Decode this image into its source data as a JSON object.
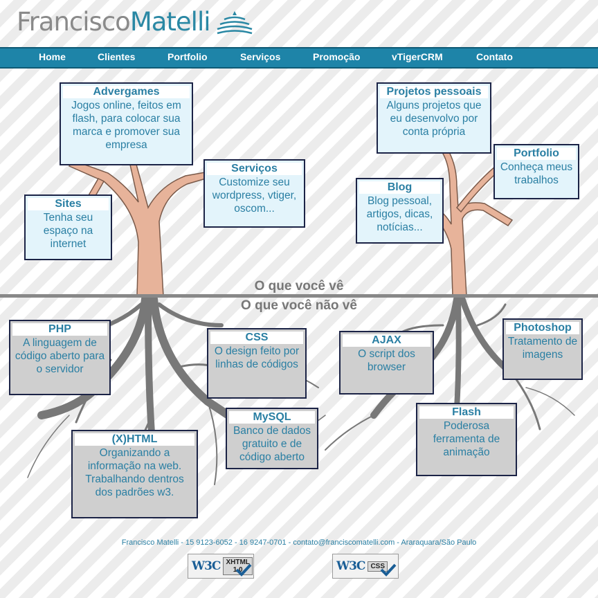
{
  "logo": {
    "first": "Francisco",
    "last": "Matelli"
  },
  "nav": {
    "items": [
      {
        "label": "Home"
      },
      {
        "label": "Clientes"
      },
      {
        "label": "Portfolio"
      },
      {
        "label": "Serviços"
      },
      {
        "label": "Promoção"
      },
      {
        "label": "vTigerCRM"
      },
      {
        "label": "Contato"
      }
    ]
  },
  "scene": {
    "seen": "O que você vê",
    "unseen": "O que você não vê"
  },
  "cards": {
    "advergames": {
      "title": "Advergames",
      "desc": "Jogos online, feitos em flash, para colocar sua marca e promover sua empresa"
    },
    "servicos": {
      "title": "Serviços",
      "desc": "Customize seu wordpress, vtiger, oscom..."
    },
    "sites": {
      "title": "Sites",
      "desc": "Tenha seu espaço na internet"
    },
    "projetos": {
      "title": "Projetos pessoais",
      "desc": "Alguns projetos que eu desenvolvo por conta própria"
    },
    "portfolio": {
      "title": "Portfolio",
      "desc": "Conheça meus trabalhos"
    },
    "blog": {
      "title": "Blog",
      "desc": "Blog pessoal, artigos, dicas, notícias..."
    },
    "php": {
      "title": "PHP",
      "desc": "A linguagem de código aberto para o servidor"
    },
    "css": {
      "title": "CSS",
      "desc": "O design feito por linhas de códigos"
    },
    "ajax": {
      "title": "AJAX",
      "desc": "O script dos browser"
    },
    "photoshop": {
      "title": "Photoshop",
      "desc": "Tratamento de imagens"
    },
    "mysql": {
      "title": "MySQL",
      "desc": "Banco de dados gratuito e de código aberto"
    },
    "xhtml": {
      "title": "(X)HTML",
      "desc": "Organizando a informação na web. Trabalhando dentros dos padrões w3."
    },
    "flash": {
      "title": "Flash",
      "desc": "Poderosa ferramenta de animação"
    }
  },
  "footer": {
    "text": "Francisco Matelli - 15 9123-6052 - 16 9247-0701 - contato@franciscomatelli.com - Araraquara/São Paulo"
  },
  "badges": {
    "xhtml": {
      "w3c": "W3C",
      "label": "XHTML\n1.0"
    },
    "css": {
      "w3c": "W3C",
      "label": "CSS"
    }
  },
  "colors": {
    "accent": "#2a88a4",
    "nav_bg": "#1e84a8",
    "trunk": "#e7b39a",
    "roots": "#777777",
    "card_border": "#1b2346"
  }
}
